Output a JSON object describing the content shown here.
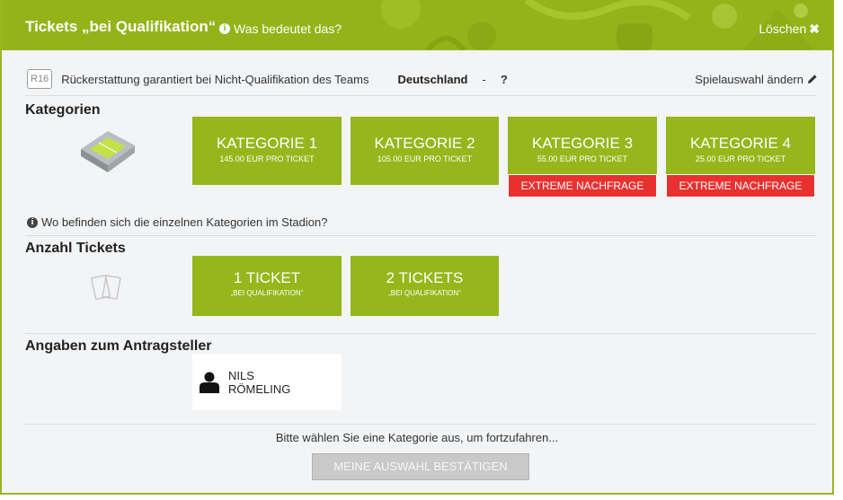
{
  "header": {
    "title": "Tickets „bei Qualifikation“",
    "info_link": "Was bedeutet das?",
    "close_label": "Löschen",
    "close_icon": "close-icon"
  },
  "match": {
    "round_badge": "R16",
    "refund_text": "Rückerstattung garantiert bei Nicht-Qualifikation des Teams",
    "team": "Deutschland",
    "separator": "-",
    "opponent": "?",
    "change_label": "Spielauswahl ändern",
    "change_icon": "pencil-icon"
  },
  "categories": {
    "title": "Kategorien",
    "items": [
      {
        "name": "KATEGORIE 1",
        "price": "145.00 EUR PRO TICKET"
      },
      {
        "name": "KATEGORIE 2",
        "price": "105.00 EUR PRO TICKET"
      },
      {
        "name": "KATEGORIE 3",
        "price": "55.00 EUR PRO TICKET",
        "badge": "EXTREME NACHFRAGE"
      },
      {
        "name": "KATEGORIE 4",
        "price": "25.00 EUR PRO TICKET",
        "badge": "EXTREME NACHFRAGE"
      }
    ],
    "stadium_hint": "Wo befinden sich die einzelnen Kategorien im Stadion?"
  },
  "tickets": {
    "title": "Anzahl Tickets",
    "items": [
      {
        "name": "1 TICKET",
        "sub": "„BEI QUALIFIKATION“"
      },
      {
        "name": "2 TICKETS",
        "sub": "„BEI QUALIFIKATION“"
      }
    ]
  },
  "applicant": {
    "title": "Angaben zum Antragsteller",
    "first_name": "NILS",
    "last_name": "RÖMELING",
    "icon": "user-icon"
  },
  "footer": {
    "hint": "Bitte wählen Sie eine Kategorie aus, um fortzufahren...",
    "confirm_label": "MEINE AUSWAHL BESTÄTIGEN"
  },
  "colors": {
    "accent_green": "#95b71b",
    "demand_red": "#e8312f",
    "disabled_gray": "#c9c9c9"
  }
}
